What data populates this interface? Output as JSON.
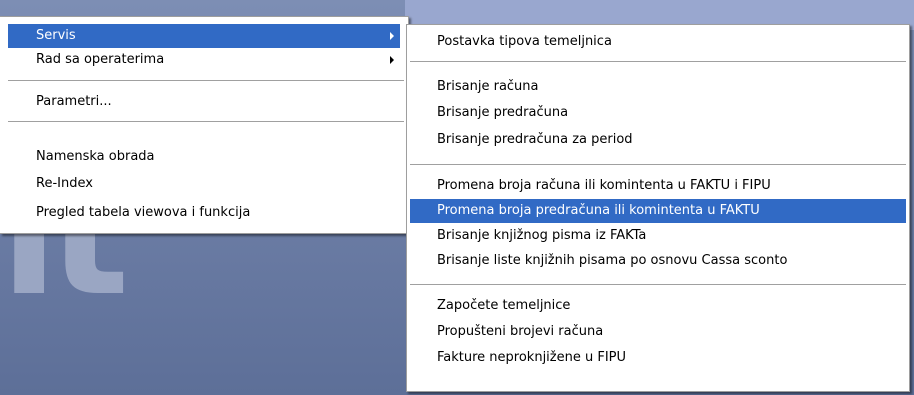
{
  "main_menu": {
    "items": [
      {
        "label": "Servis"
      },
      {
        "label": "Rad sa operaterima"
      },
      {
        "label": "Parametri..."
      },
      {
        "label": "Namenska obrada"
      },
      {
        "label": "Re-Index"
      },
      {
        "label": "Pregled tabela viewova i funkcija"
      }
    ]
  },
  "sub_menu": {
    "items": [
      {
        "label": "Postavka tipova temeljnica"
      },
      {
        "label": "Brisanje računa"
      },
      {
        "label": "Brisanje predračuna"
      },
      {
        "label": "Brisanje predračuna za period"
      },
      {
        "label": "Promena broja računa ili komintenta u FAKTU i FIPU"
      },
      {
        "label": "Promena broja predračuna ili komintenta u FAKTU"
      },
      {
        "label": "Brisanje knjižnog pisma iz FAKTa"
      },
      {
        "label": "Brisanje liste knjižnih pisama po osnovu Cassa sconto"
      },
      {
        "label": "Započete temeljnice"
      },
      {
        "label": "Propušteni brojevi računa"
      },
      {
        "label": "Fakture neproknjižene u FIPU"
      }
    ]
  },
  "colors": {
    "highlight": "#316ac5",
    "menu_background": "#ffffff",
    "desktop_background": "#6e7fa7"
  },
  "icons": [
    "submenu-arrow-icon"
  ]
}
